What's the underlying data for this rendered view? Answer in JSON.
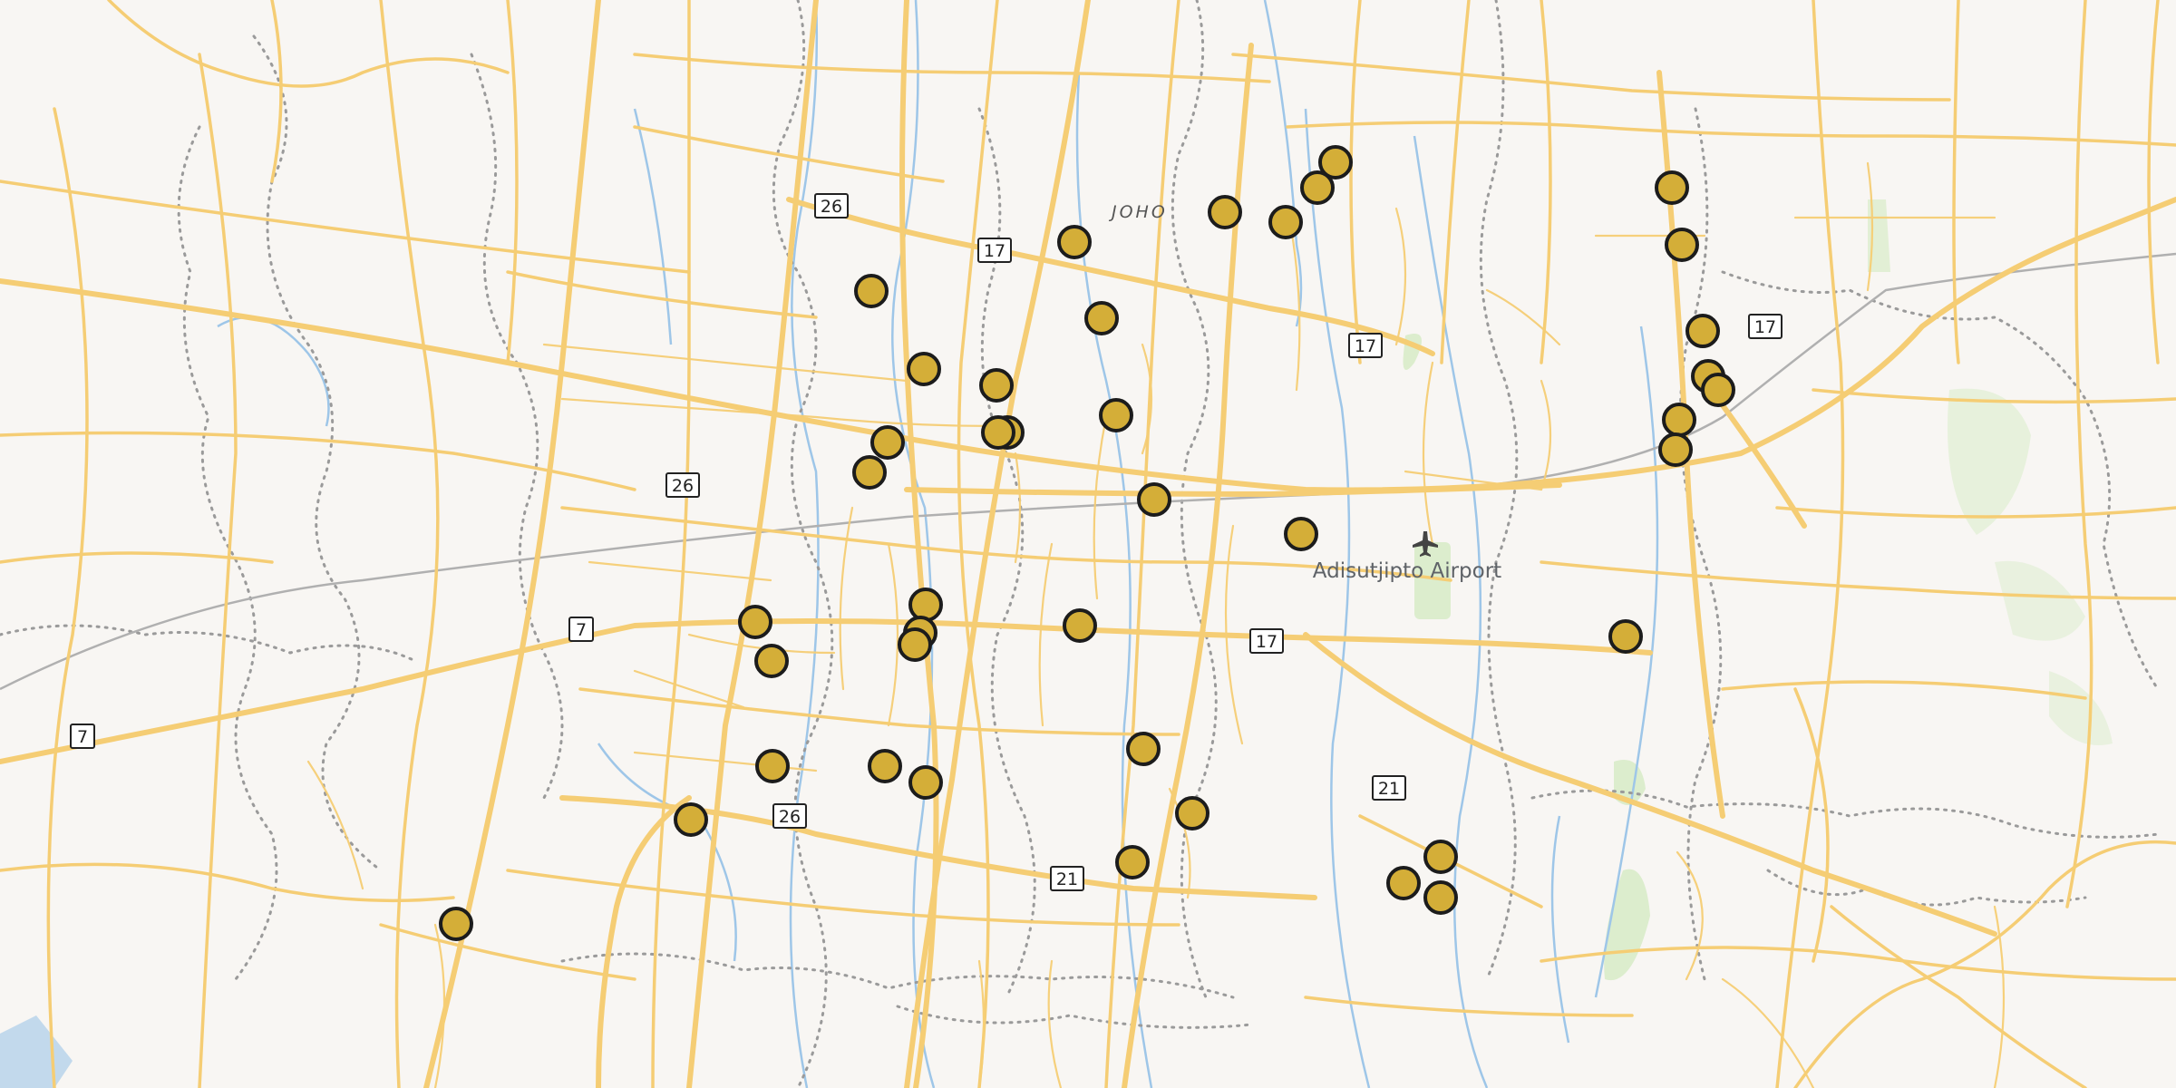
{
  "map": {
    "place_labels": [
      {
        "id": "joho",
        "text": "JOHO"
      }
    ],
    "airport": {
      "label": "Adisutjipto Airport",
      "icon": "airplane-icon"
    },
    "route_shields": [
      {
        "id": "r26a",
        "num": "26"
      },
      {
        "id": "r17a",
        "num": "17"
      },
      {
        "id": "r17b",
        "num": "17"
      },
      {
        "id": "r17c",
        "num": "17"
      },
      {
        "id": "r26b",
        "num": "26"
      },
      {
        "id": "r7a",
        "num": "7"
      },
      {
        "id": "r17d",
        "num": "17"
      },
      {
        "id": "r7b",
        "num": "7"
      },
      {
        "id": "r21a",
        "num": "21"
      },
      {
        "id": "r26c",
        "num": "26"
      },
      {
        "id": "r21b",
        "num": "21"
      }
    ],
    "colors": {
      "background": "#f8f6f3",
      "road": "#f5cd74",
      "marker_fill": "#d4ae38",
      "marker_stroke": "#1c1c1c",
      "water": "#9ec6e8",
      "boundary": "#9a9a9a",
      "park": "#d9ecc9"
    }
  }
}
